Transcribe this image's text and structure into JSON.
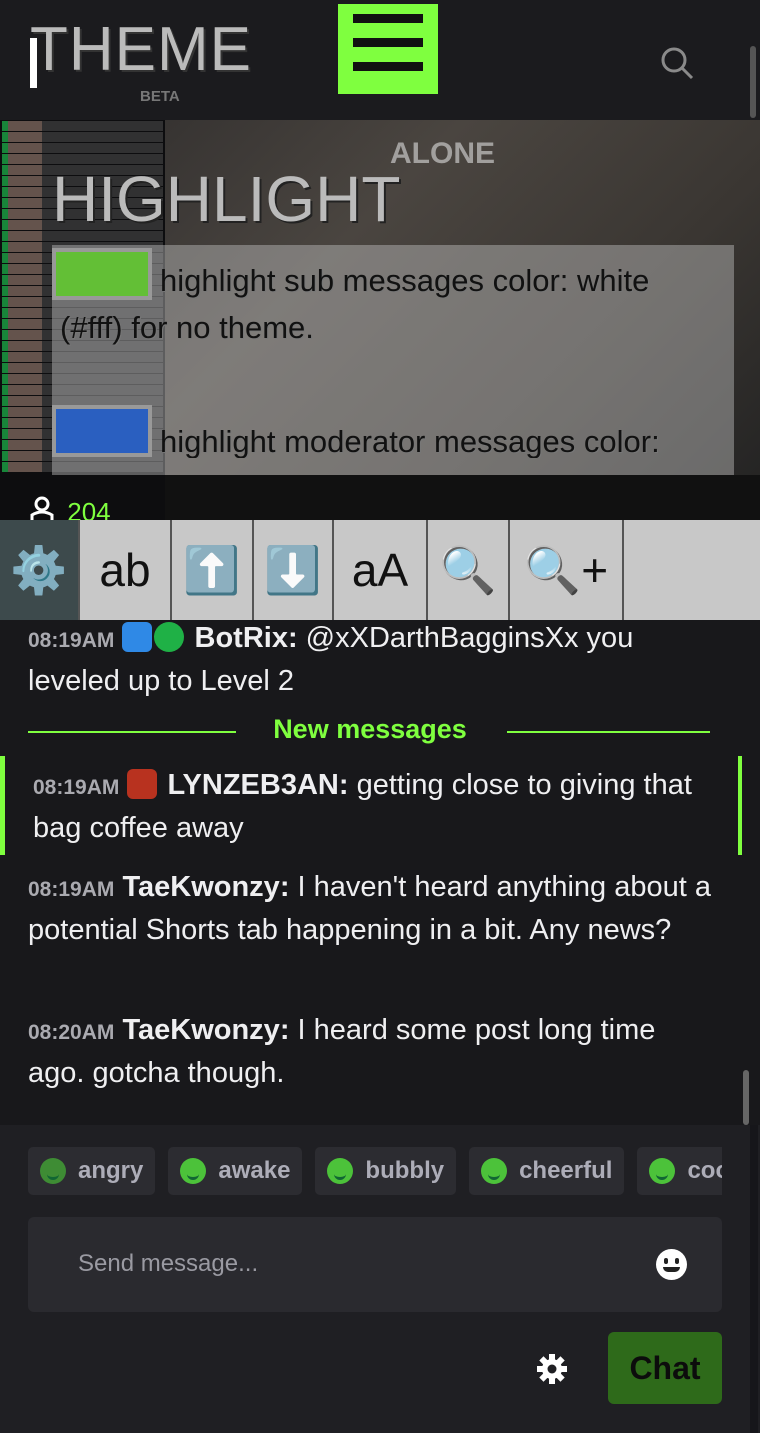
{
  "header": {
    "logo_text": "THEME",
    "beta_label": "BETA",
    "menu_icon": "hamburger-icon",
    "search_icon": "search-icon"
  },
  "video": {
    "overlay_text": "ALONE",
    "viewer_count": "204"
  },
  "highlight_panel": {
    "title": "HIGHLIGHT",
    "sub_color": "#63bf36",
    "sub_text": "highlight sub messages color: white (#fff) for no theme.",
    "mod_color": "#2a5fc0",
    "mod_text": "highlight moderator messages color:"
  },
  "toolbar": [
    {
      "name": "settings-tool-button",
      "label": "⚙️"
    },
    {
      "name": "font-toggle-button",
      "label": "ab"
    },
    {
      "name": "scroll-up-button",
      "label": "⬆️"
    },
    {
      "name": "scroll-down-button",
      "label": "⬇️"
    },
    {
      "name": "text-size-button",
      "label": "aA"
    },
    {
      "name": "search-button",
      "label": "🔍"
    },
    {
      "name": "zoom-in-button",
      "label": "🔍+"
    }
  ],
  "chat": {
    "messages": [
      {
        "time": "08:19AM",
        "user": "BotRix:",
        "text": " @xXDarthBagginsXx you leveled up to Level 2"
      },
      {
        "time": "08:19AM",
        "user": "LYNZEB3AN:",
        "text": " getting close to giving that bag coffee away"
      },
      {
        "time": "08:19AM",
        "user": "TaeKwonzy:",
        "text": " I haven't heard anything about a potential Shorts tab happening in a bit. Any news?"
      },
      {
        "time": "08:20AM",
        "user": "TaeKwonzy:",
        "text": " I heard some post long time ago. gotcha though."
      }
    ],
    "divider_label": "New messages"
  },
  "moods": [
    "angry",
    "awake",
    "bubbly",
    "cheerful",
    "coo"
  ],
  "composer": {
    "placeholder": "Send message...",
    "chat_button": "Chat"
  },
  "colors": {
    "accent": "#7fff3f",
    "background": "#18181b"
  }
}
